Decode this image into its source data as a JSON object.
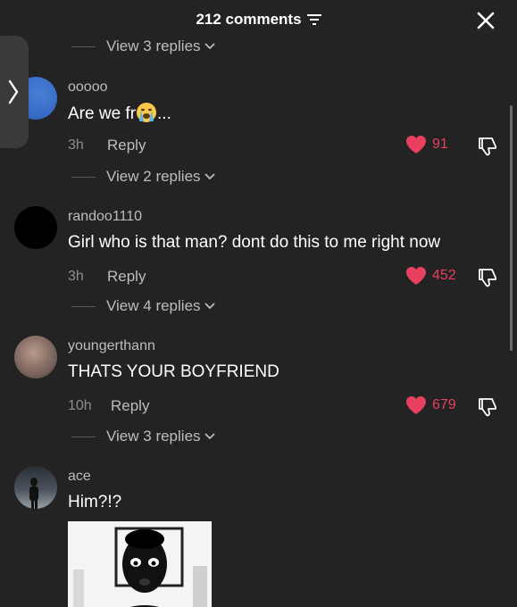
{
  "header": {
    "title": "212 comments",
    "filter_icon": "filter-lines-icon",
    "close_icon": "close-icon"
  },
  "replies_top": "View 3 replies",
  "comments": [
    {
      "username": "ooooo",
      "text": "Are we fr",
      "emoji": "crying-face",
      "ellipsis": "...",
      "time": "3h",
      "reply_label": "Reply",
      "likes": "91",
      "view_replies": "View 2 replies"
    },
    {
      "username": "randoo1110",
      "text": "Girl who is that man? dont do this to me right now",
      "time": "3h",
      "reply_label": "Reply",
      "likes": "452",
      "view_replies": "View 4 replies"
    },
    {
      "username": "youngerthann",
      "text": "THATS YOUR BOYFRIEND",
      "time": "10h",
      "reply_label": "Reply",
      "likes": "679",
      "view_replies": "View 3 replies"
    },
    {
      "username": "ace",
      "text": "Him?!?"
    }
  ],
  "colors": {
    "background": "#232323",
    "like_red": "#e8405e",
    "secondary_text": "#bdbdbd"
  }
}
